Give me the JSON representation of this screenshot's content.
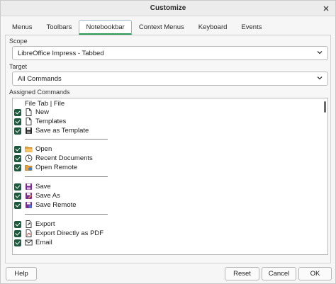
{
  "window": {
    "title": "Customize"
  },
  "tabs": [
    {
      "label": "Menus"
    },
    {
      "label": "Toolbars"
    },
    {
      "label": "Notebookbar",
      "active": true
    },
    {
      "label": "Context Menus"
    },
    {
      "label": "Keyboard"
    },
    {
      "label": "Events"
    }
  ],
  "scope": {
    "label": "Scope",
    "value": "LibreOffice Impress - Tabbed"
  },
  "target": {
    "label": "Target",
    "value": "All Commands"
  },
  "assigned": {
    "label": "Assigned Commands",
    "heading": "File Tab | File",
    "items": [
      {
        "label": "New",
        "icon": "document-icon",
        "checked": true
      },
      {
        "label": "Templates",
        "icon": "document-icon",
        "checked": true
      },
      {
        "label": "Save as Template",
        "icon": "floppy-icon",
        "checked": true
      },
      {
        "label": "Open",
        "icon": "folder-icon",
        "checked": true
      },
      {
        "label": "Recent Documents",
        "icon": "clock-icon",
        "checked": true
      },
      {
        "label": "Open Remote",
        "icon": "remote-folder-icon",
        "checked": true
      },
      {
        "label": "Save",
        "icon": "save-icon",
        "checked": true
      },
      {
        "label": "Save As",
        "icon": "save-as-icon",
        "checked": true
      },
      {
        "label": "Save Remote",
        "icon": "save-remote-icon",
        "checked": true
      },
      {
        "label": "Export",
        "icon": "export-icon",
        "checked": true
      },
      {
        "label": "Export Directly as PDF",
        "icon": "pdf-icon",
        "checked": true
      },
      {
        "label": "Email",
        "icon": "email-icon",
        "checked": true
      }
    ]
  },
  "buttons": {
    "help": "Help",
    "reset": "Reset",
    "cancel": "Cancel",
    "ok": "OK"
  },
  "colors": {
    "checkbox": "#1f5a3f",
    "tab_accent": "#2e9a58",
    "save_icon": "#7b2d8e",
    "folder_icon": "#e8a23a"
  }
}
